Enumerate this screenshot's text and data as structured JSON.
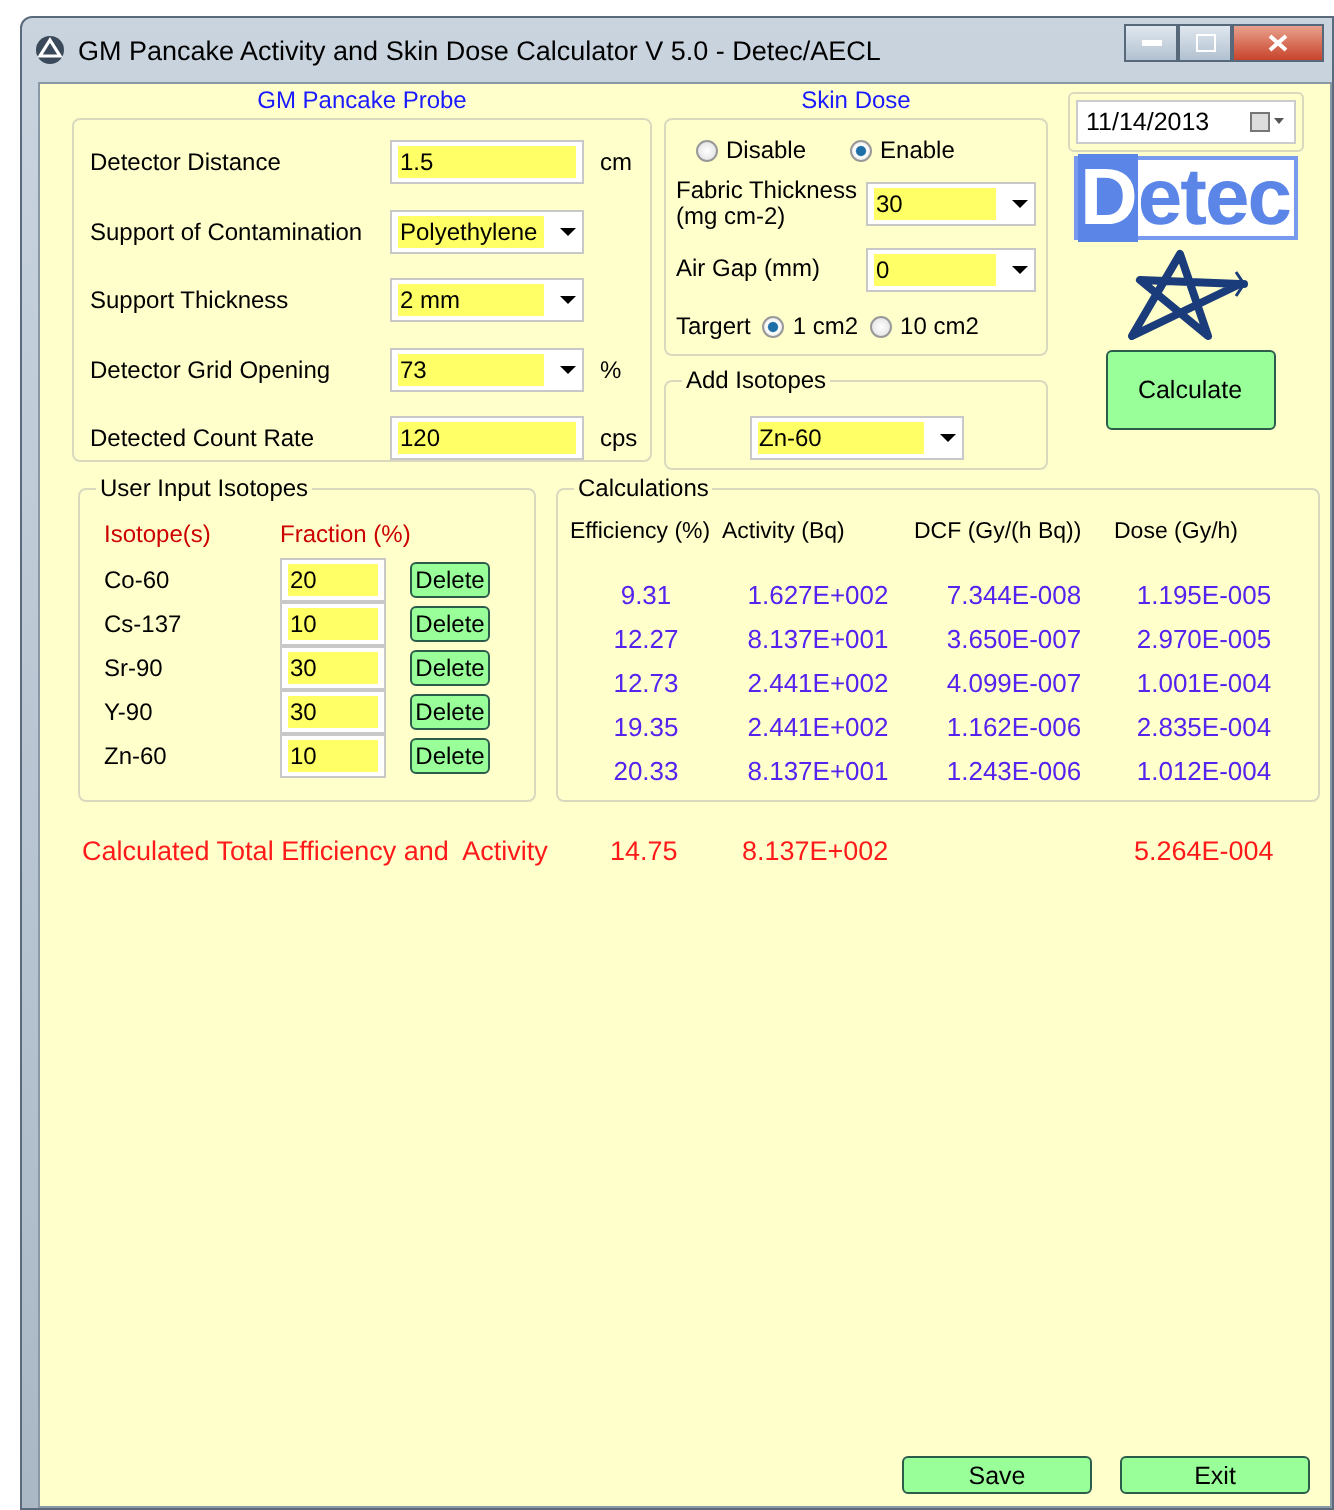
{
  "window": {
    "title": "GM Pancake Activity and Skin Dose Calculator V 5.0 - Detec/AECL"
  },
  "probe": {
    "title": "GM Pancake Probe",
    "fields": [
      {
        "label": "Detector Distance",
        "kind": "text",
        "value": "1.5",
        "unit": "cm"
      },
      {
        "label": "Support of Contamination",
        "kind": "dropdown",
        "value": "Polyethylene"
      },
      {
        "label": "Support Thickness",
        "kind": "dropdown",
        "value": "2 mm"
      },
      {
        "label": "Detector Grid Opening",
        "kind": "dropdown",
        "value": "73",
        "unit": "%"
      },
      {
        "label": "Detected Count Rate",
        "kind": "text",
        "value": "120",
        "unit": "cps"
      }
    ]
  },
  "skin_dose": {
    "title": "Skin Dose",
    "modes": [
      {
        "label": "Disable",
        "selected": false
      },
      {
        "label": "Enable",
        "selected": true
      }
    ],
    "fields": [
      {
        "label": "Fabric Thickness (mg cm-2)",
        "value": "30"
      },
      {
        "label": "Air Gap (mm)",
        "value": "0"
      }
    ],
    "target": {
      "label": "Targert",
      "options": [
        {
          "label": "1 cm2",
          "selected": true
        },
        {
          "label": "10 cm2",
          "selected": false
        }
      ]
    }
  },
  "add_isotopes": {
    "title": "Add Isotopes",
    "value": "Zn-60"
  },
  "date": "11/14/2013",
  "logo": "Detec",
  "calculate_button": "Calculate",
  "user_isotopes": {
    "title": "User Input Isotopes",
    "columns": [
      "Isotope(s)",
      "Fraction (%)"
    ],
    "rows": [
      {
        "isotope": "Co-60",
        "fraction": "20",
        "button": "Delete"
      },
      {
        "isotope": "Cs-137",
        "fraction": "10",
        "button": "Delete"
      },
      {
        "isotope": "Sr-90",
        "fraction": "30",
        "button": "Delete"
      },
      {
        "isotope": "Y-90",
        "fraction": "30",
        "button": "Delete"
      },
      {
        "isotope": "Zn-60",
        "fraction": "10",
        "button": "Delete"
      }
    ]
  },
  "calculations": {
    "title": "Calculations",
    "columns": [
      "Efficiency (%)",
      "Activity (Bq)",
      "DCF (Gy/(h Bq))",
      "Dose (Gy/h)"
    ],
    "rows": [
      [
        "9.31",
        "1.627E+002",
        "7.344E-008",
        "1.195E-005"
      ],
      [
        "12.27",
        "8.137E+001",
        "3.650E-007",
        "2.970E-005"
      ],
      [
        "12.73",
        "2.441E+002",
        "4.099E-007",
        "1.001E-004"
      ],
      [
        "19.35",
        "2.441E+002",
        "1.162E-006",
        "2.835E-004"
      ],
      [
        "20.33",
        "8.137E+001",
        "1.243E-006",
        "1.012E-004"
      ]
    ]
  },
  "totals": {
    "label": "Calculated Total Efficiency and  Activity",
    "efficiency": "14.75",
    "activity": "8.137E+002",
    "dose": "5.264E-004"
  },
  "buttons": [
    "Save",
    "Exit"
  ]
}
